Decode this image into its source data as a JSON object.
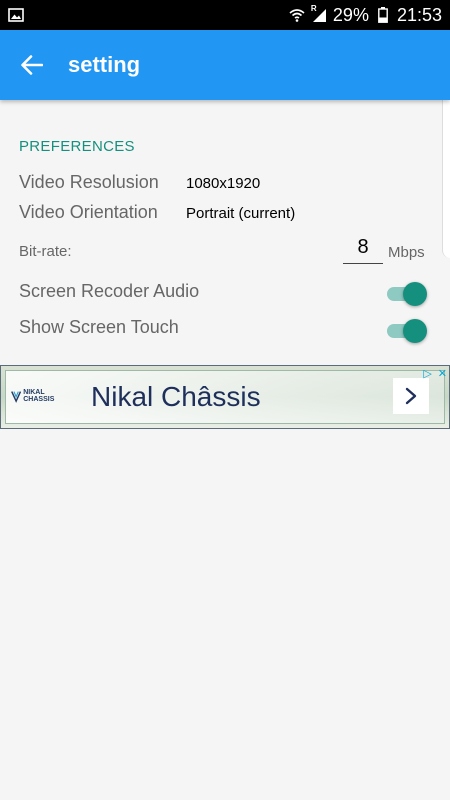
{
  "status_bar": {
    "battery_percent": "29%",
    "time": "21:53",
    "signal_label": "R"
  },
  "app_bar": {
    "title": "setting"
  },
  "preferences": {
    "header": "PREFERENCES",
    "video_resolution": {
      "label": "Video Resolusion",
      "value": "1080x1920"
    },
    "video_orientation": {
      "label": "Video Orientation",
      "value": "Portrait (current)"
    },
    "bitrate": {
      "label": "Bit-rate:",
      "value": "8",
      "unit": "Mbps"
    },
    "screen_audio": {
      "label": "Screen Recoder Audio",
      "enabled": true
    },
    "show_touch": {
      "label": "Show Screen Touch",
      "enabled": true
    }
  },
  "ad": {
    "logo_text": "NIKAL CHASSIS",
    "headline": "Nikal Châssis"
  },
  "colors": {
    "app_bar": "#2196f3",
    "accent": "#16907e",
    "toggle_track": "#8ec9c2"
  }
}
